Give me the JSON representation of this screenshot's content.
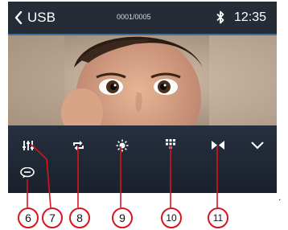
{
  "statusbar": {
    "back_label": "USB",
    "track_counter": "0001/0005",
    "time": "12:35"
  },
  "controls": [
    {
      "id": "equalizer",
      "icon": "equalizer-icon"
    },
    {
      "id": "repeat",
      "icon": "repeat-icon"
    },
    {
      "id": "brightness",
      "icon": "brightness-icon"
    },
    {
      "id": "keypad",
      "icon": "keypad-icon"
    },
    {
      "id": "zoom",
      "icon": "zoom-icon"
    },
    {
      "id": "more",
      "icon": "chevron-down-icon"
    },
    {
      "id": "subtitle",
      "icon": "subtitle-icon"
    }
  ],
  "callouts": [
    "6",
    "7",
    "8",
    "9",
    "10",
    "11"
  ],
  "edge_mark": ".",
  "colors": {
    "accent": "#3d6fa3",
    "callout_border": "#d8141f",
    "bar_bg": "#262c35"
  }
}
